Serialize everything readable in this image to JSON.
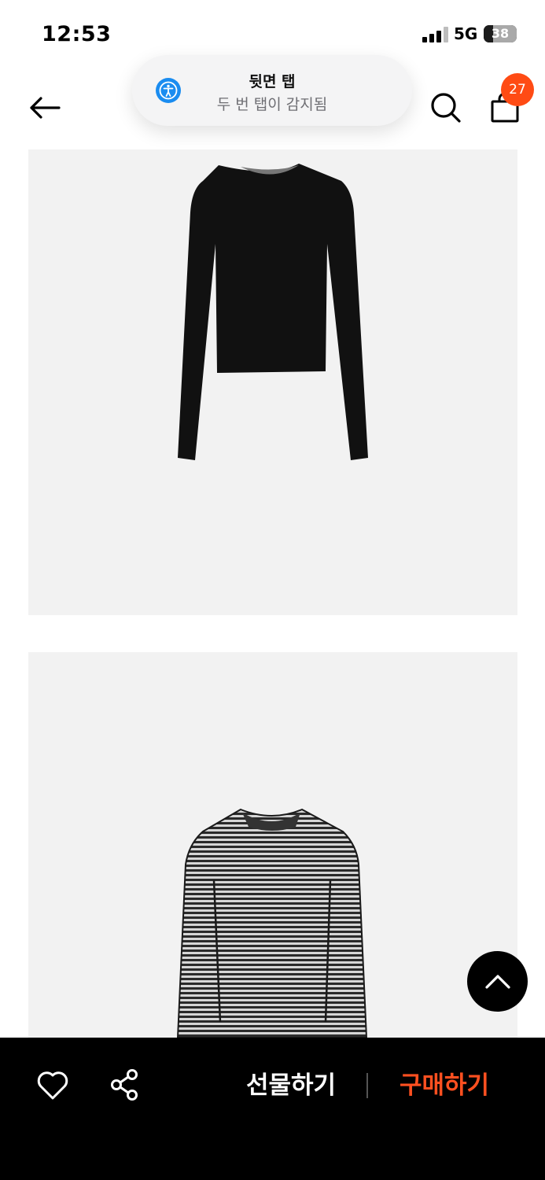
{
  "status_bar": {
    "time": "12:53",
    "network": "5G",
    "battery": "38"
  },
  "toast": {
    "title": "뒷면 탭",
    "subtitle": "두 번 탭이 감지됨",
    "icon": "accessibility-icon"
  },
  "nav": {
    "back_icon": "arrow-left-icon",
    "search_icon": "search-icon",
    "cart_icon": "shopping-bag-icon",
    "cart_count": "27"
  },
  "products": [
    {
      "name": "black-long-sleeve-top",
      "color": "#111111"
    },
    {
      "name": "striped-long-sleeve-top",
      "color": "#3a3a3a"
    }
  ],
  "bottom_bar": {
    "like_icon": "heart-icon",
    "share_icon": "share-icon",
    "gift_label": "선물하기",
    "buy_label": "구매하기"
  },
  "colors": {
    "accent": "#ff4b14",
    "buy": "#ff5020",
    "toast_icon": "#1a8cf0"
  }
}
